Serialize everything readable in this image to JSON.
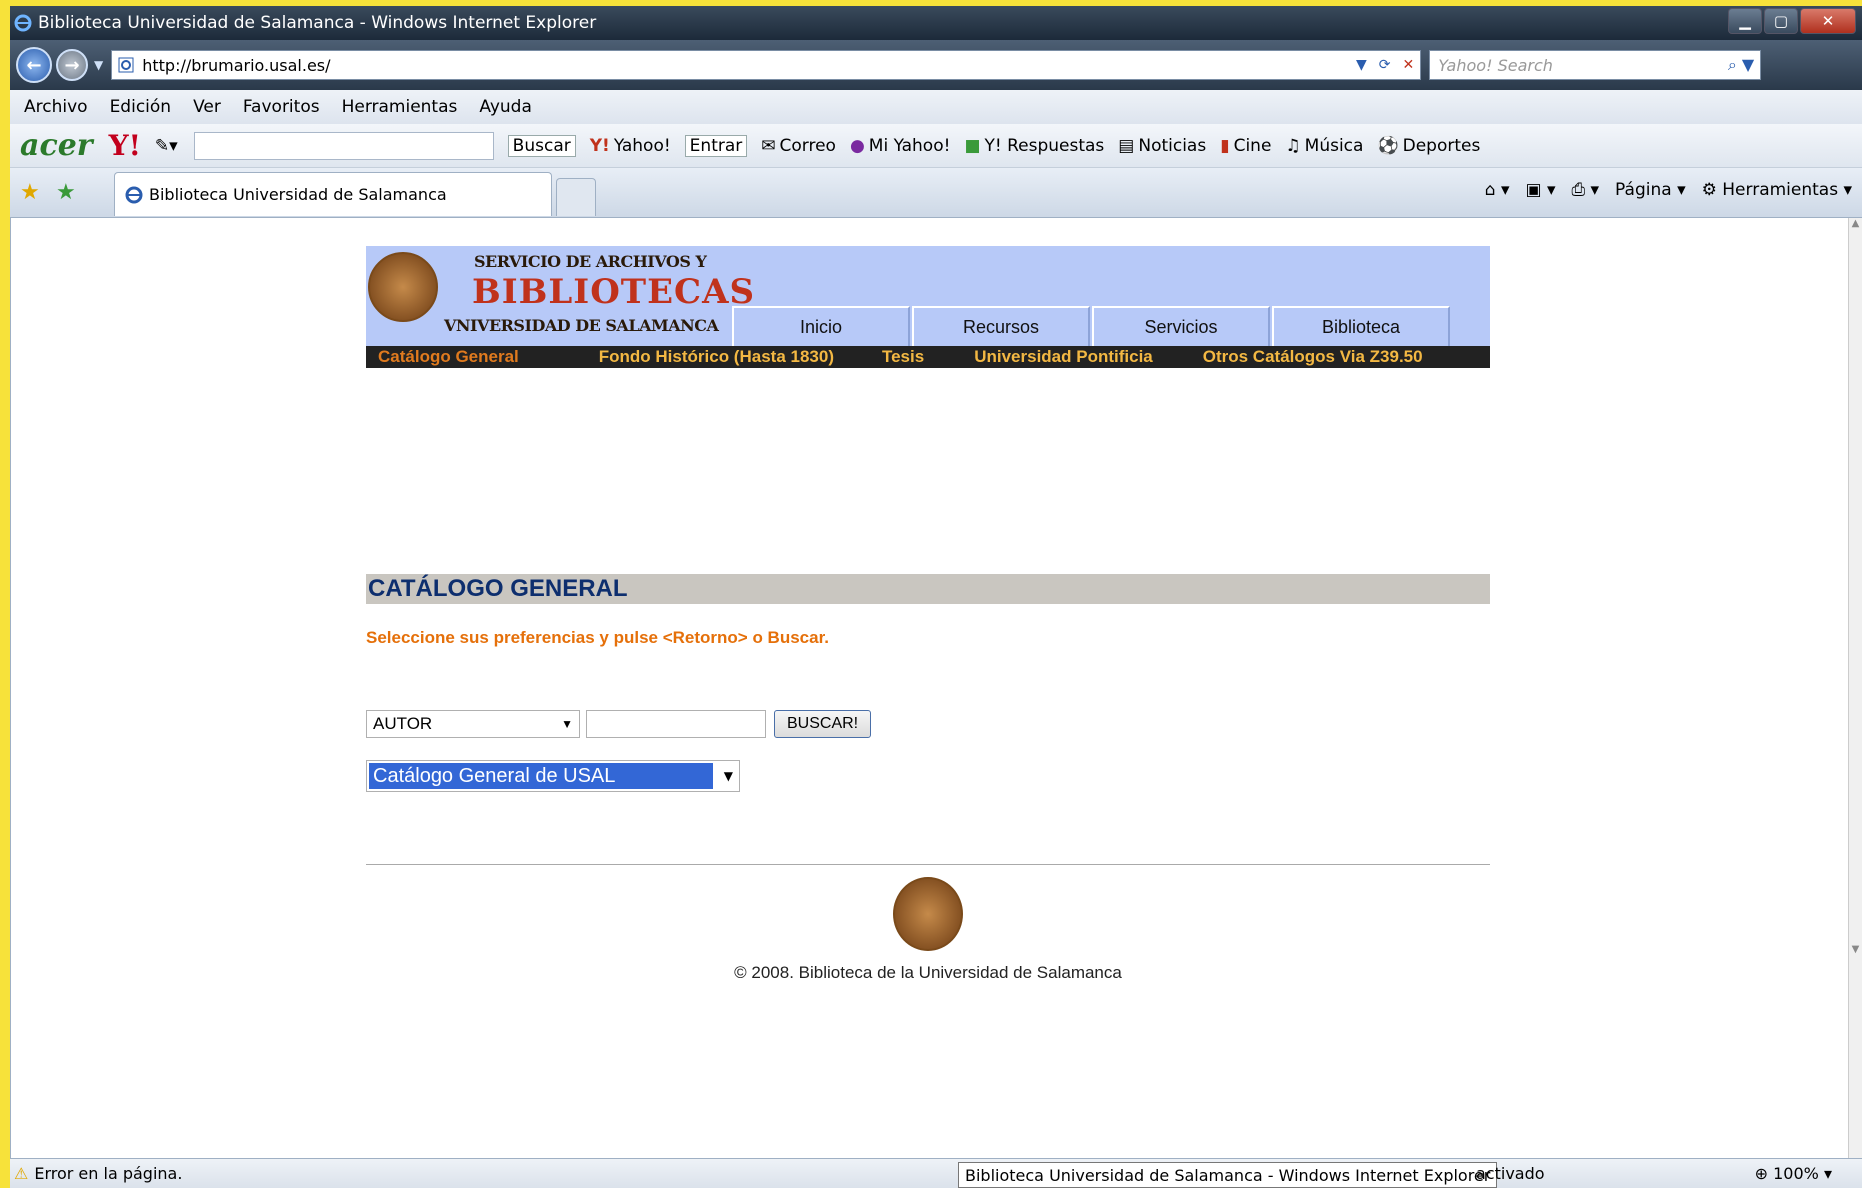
{
  "window": {
    "title": "Biblioteca Universidad de Salamanca - Windows Internet Explorer"
  },
  "address": {
    "url": "http://brumario.usal.es/",
    "search_placeholder": "Yahoo! Search"
  },
  "menu": [
    "Archivo",
    "Edición",
    "Ver",
    "Favoritos",
    "Herramientas",
    "Ayuda"
  ],
  "toolbar": {
    "brand": "acer",
    "yahoo_logo": "Y!",
    "buscar": "Buscar",
    "items": [
      "Yahoo!",
      "Entrar",
      "Correo",
      "Mi Yahoo!",
      "Y! Respuestas",
      "Noticias",
      "Cine",
      "Música",
      "Deportes"
    ]
  },
  "tab": {
    "label": "Biblioteca Universidad de Salamanca"
  },
  "commands": {
    "page": "Página",
    "tools": "Herramientas"
  },
  "site": {
    "brand_line1": "SERVICIO DE ARCHIVOS Y",
    "brand_line2": "BIBLIOTECAS",
    "brand_line3": "VNIVERSIDAD DE SALAMANCA",
    "tabs": [
      "Inicio",
      "Recursos",
      "Servicios",
      "Biblioteca"
    ],
    "subnav": [
      "Catálogo General",
      "Fondo Histórico (Hasta 1830)",
      "Tesis",
      "Universidad Pontificia",
      "Otros Catálogos Via Z39.50"
    ]
  },
  "main": {
    "title": "CATÁLOGO GENERAL",
    "instructions": "Seleccione sus preferencias y pulse <Retorno> o Buscar.",
    "field_select": "AUTOR",
    "search_value": "",
    "search_button": "BUSCAR!",
    "catalog_select": "Catálogo General de USAL"
  },
  "footer": {
    "copyright": "© 2008. Biblioteca de la Universidad de Salamanca"
  },
  "status": {
    "message": "Error en la página.",
    "tooltip": "Biblioteca Universidad de Salamanca - Windows Internet Explorer",
    "mode": "activado",
    "zoom": "100%"
  }
}
